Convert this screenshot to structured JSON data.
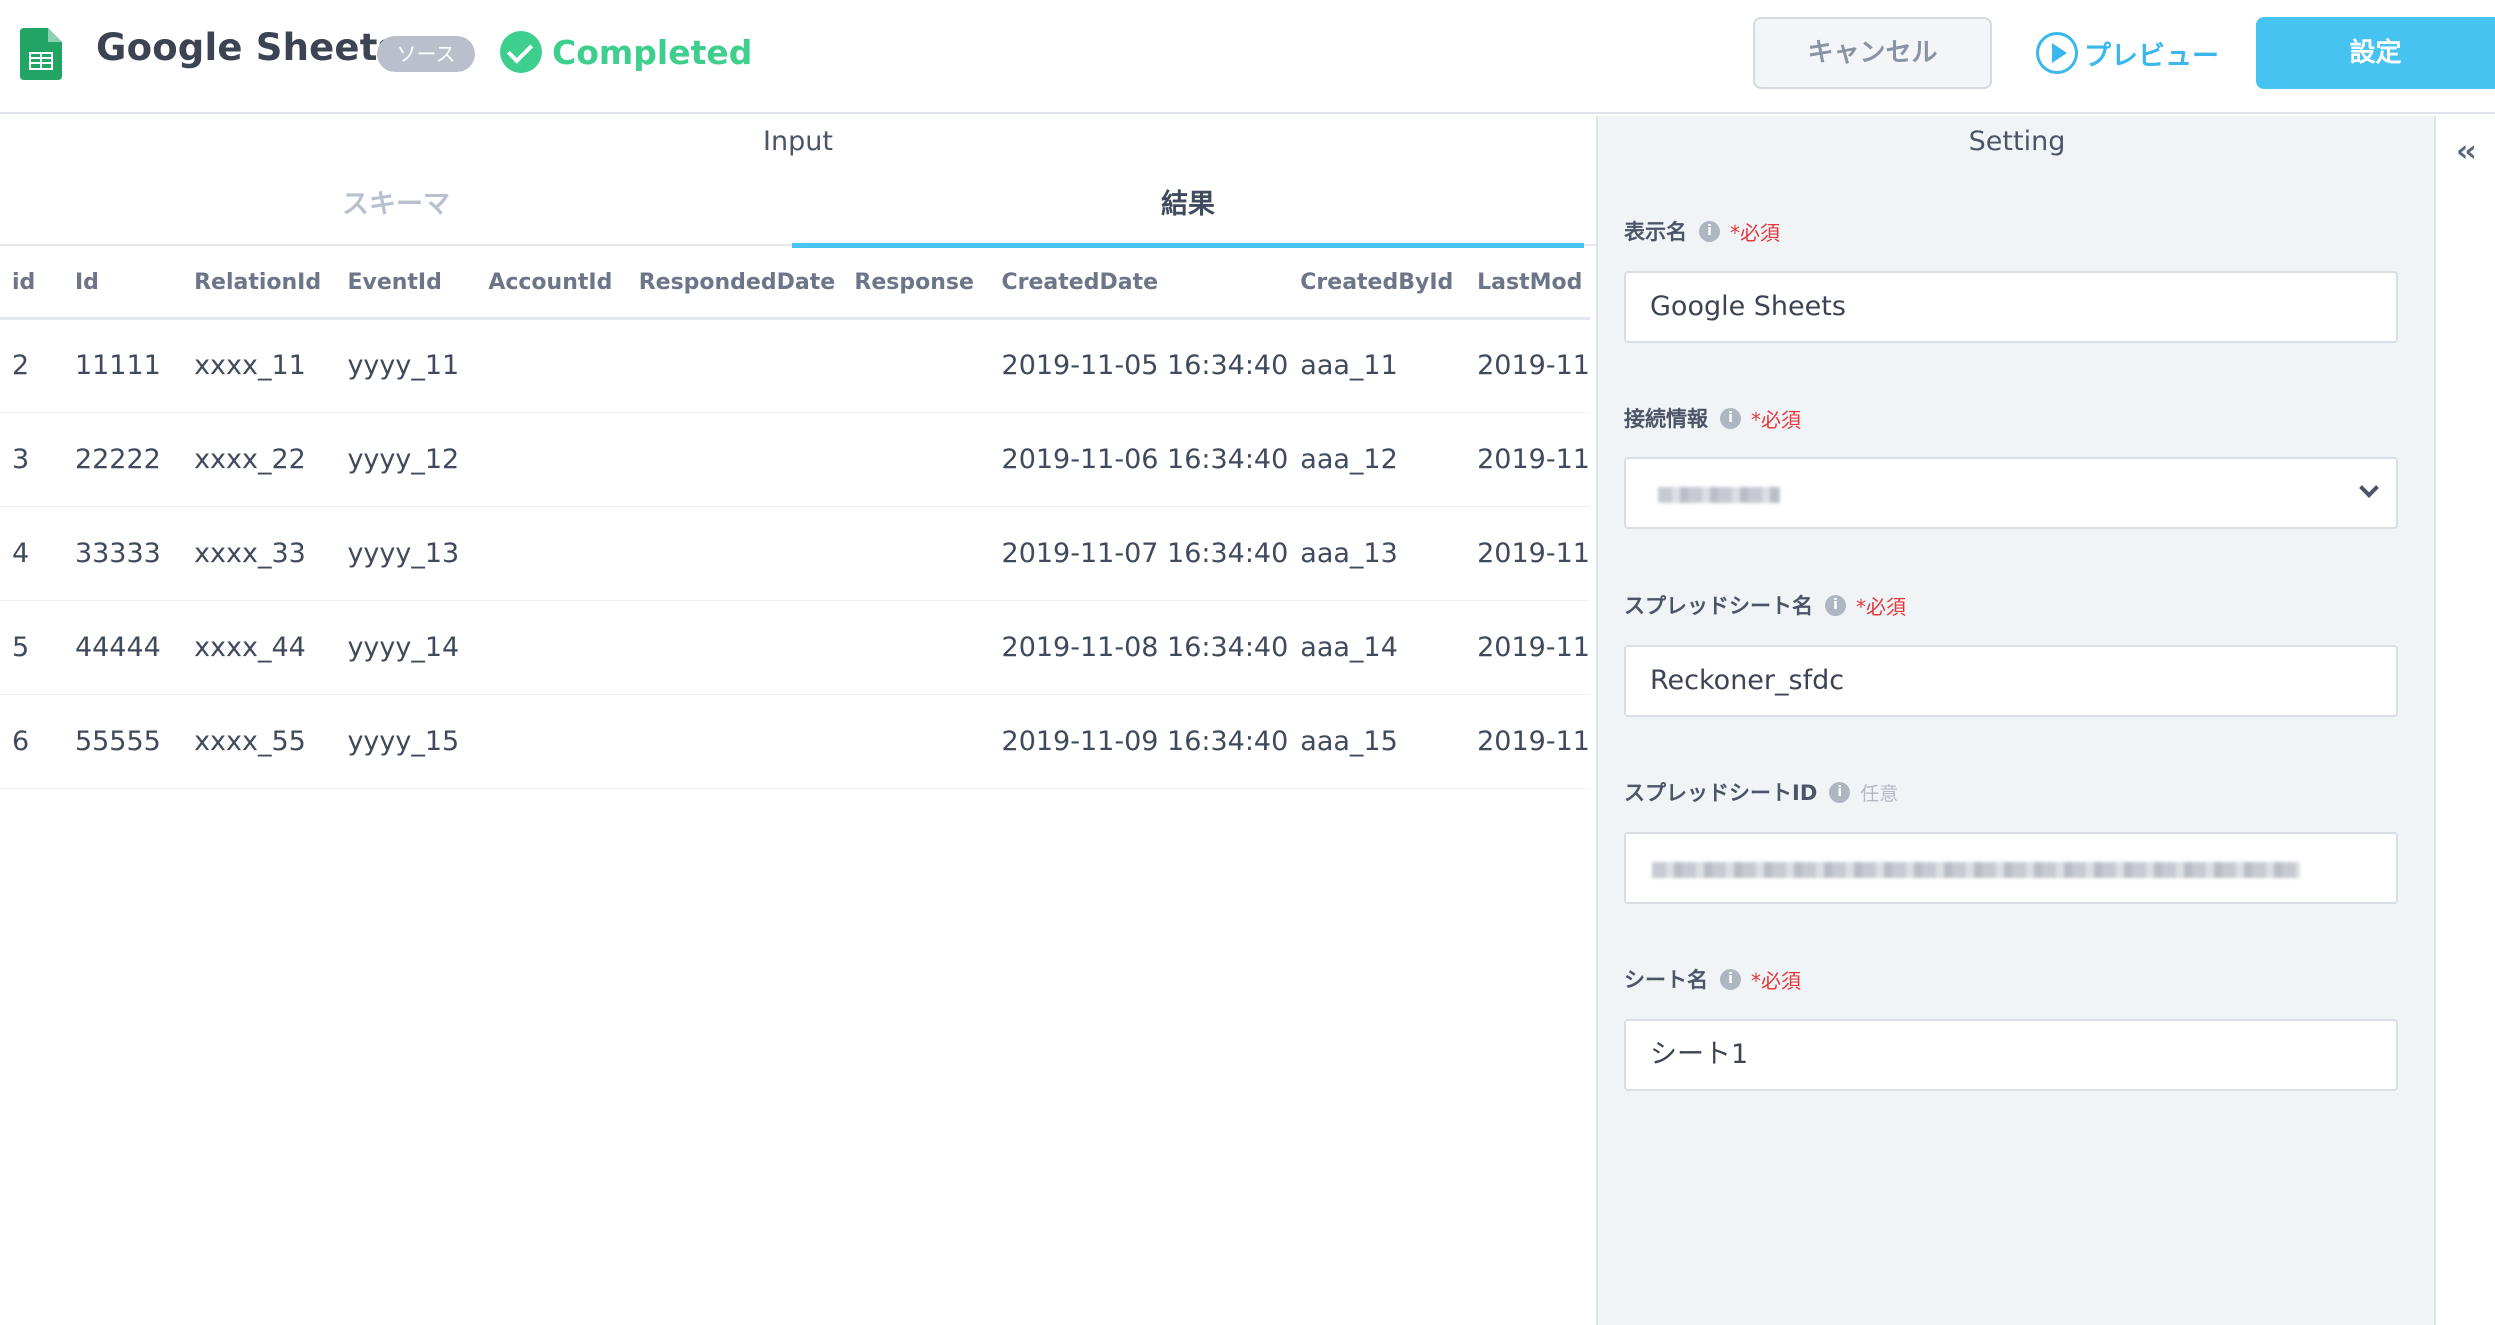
{
  "header": {
    "title": "Google Sheets",
    "badge": "ソース",
    "status": "Completed",
    "cancel_label": "キャンセル",
    "preview_label": "プレビュー",
    "settings_label": "設定"
  },
  "input_panel": {
    "title": "Input",
    "tabs": [
      {
        "label": "スキーマ",
        "active": false
      },
      {
        "label": "結果",
        "active": true
      }
    ],
    "table": {
      "columns": [
        "id",
        "Id",
        "RelationId",
        "EventId",
        "AccountId",
        "RespondedDate",
        "Response",
        "CreatedDate",
        "CreatedById",
        "LastMod"
      ],
      "rows": [
        [
          "2",
          "11111",
          "xxxx_11",
          "yyyy_11",
          "",
          "",
          "",
          "2019-11-05 16:34:40",
          "aaa_11",
          "2019-11"
        ],
        [
          "3",
          "22222",
          "xxxx_22",
          "yyyy_12",
          "",
          "",
          "",
          "2019-11-06 16:34:40",
          "aaa_12",
          "2019-11"
        ],
        [
          "4",
          "33333",
          "xxxx_33",
          "yyyy_13",
          "",
          "",
          "",
          "2019-11-07 16:34:40",
          "aaa_13",
          "2019-11"
        ],
        [
          "5",
          "44444",
          "xxxx_44",
          "yyyy_14",
          "",
          "",
          "",
          "2019-11-08 16:34:40",
          "aaa_14",
          "2019-11"
        ],
        [
          "6",
          "55555",
          "xxxx_55",
          "yyyy_15",
          "",
          "",
          "",
          "2019-11-09 16:34:40",
          "aaa_15",
          "2019-11"
        ]
      ]
    }
  },
  "setting_panel": {
    "title": "Setting",
    "fields": [
      {
        "label": "表示名",
        "tag": "*必須",
        "value": "Google Sheets"
      },
      {
        "label": "接続情報",
        "tag": "*必須",
        "value": ""
      },
      {
        "label": "スプレッドシート名",
        "tag": "*必須",
        "value": "Reckoner_sfdc"
      },
      {
        "label": "スプレッドシートID",
        "tag": "任意",
        "value": ""
      },
      {
        "label": "シート名",
        "tag": "*必須",
        "value": "シート1"
      }
    ]
  },
  "colors": {
    "accent": "#47c3f2",
    "success": "#3ecf8e",
    "required": "#e5383b"
  }
}
